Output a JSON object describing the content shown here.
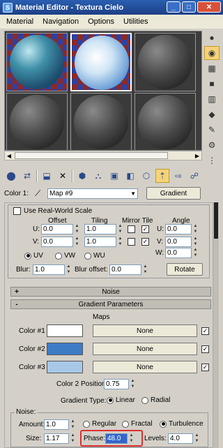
{
  "window": {
    "title": "Material Editor - Textura Cielo",
    "app_icon": "3ds-max-icon",
    "min": "_",
    "max": "□",
    "close": "✕"
  },
  "menu": [
    "Material",
    "Navigation",
    "Options",
    "Utilities"
  ],
  "color_row": {
    "label": "Color 1:",
    "map_name": "Map #9",
    "type_button": "Gradient"
  },
  "coordinates": {
    "use_real_world": "Use Real-World Scale",
    "headers": {
      "offset": "Offset",
      "tiling": "Tiling",
      "mirror_tile": "Mirror Tile",
      "angle": "Angle"
    },
    "u": {
      "label": "U:",
      "offset": "0.0",
      "tiling": "1.0",
      "angle_label": "U:",
      "angle": "0.0"
    },
    "v": {
      "label": "V:",
      "offset": "0.0",
      "tiling": "1.0",
      "angle_label": "V:",
      "angle": "0.0"
    },
    "w": {
      "angle_label": "W:",
      "angle": "0.0"
    },
    "mapping": {
      "uv": "UV",
      "vw": "VW",
      "wu": "WU"
    },
    "blur_label": "Blur:",
    "blur": "1.0",
    "blur_offset_label": "Blur offset:",
    "blur_offset": "0.0",
    "rotate": "Rotate"
  },
  "rollouts": {
    "noise": "Noise",
    "gradient": "Gradient Parameters",
    "plus": "+",
    "minus": "-"
  },
  "gradient": {
    "maps_label": "Maps",
    "colors": [
      {
        "label": "Color #1",
        "map": "None",
        "swatch": "#ffffff"
      },
      {
        "label": "Color #2",
        "map": "None",
        "swatch": "#3e7cc6"
      },
      {
        "label": "Color #3",
        "map": "None",
        "swatch": "#a8c8e8"
      }
    ],
    "color2_pos_label": "Color 2 Position:",
    "color2_pos": "0.75",
    "gradient_type_label": "Gradient Type:",
    "linear": "Linear",
    "radial": "Radial",
    "noise_group": "Noise:",
    "amount_label": "Amount:",
    "amount": "1.0",
    "regular": "Regular",
    "fractal": "Fractal",
    "turbulence": "Turbulence",
    "size_label": "Size:",
    "size": "1.17",
    "phase_label": "Phase:",
    "phase": "48.0",
    "levels_label": "Levels:",
    "levels": "4.0"
  }
}
